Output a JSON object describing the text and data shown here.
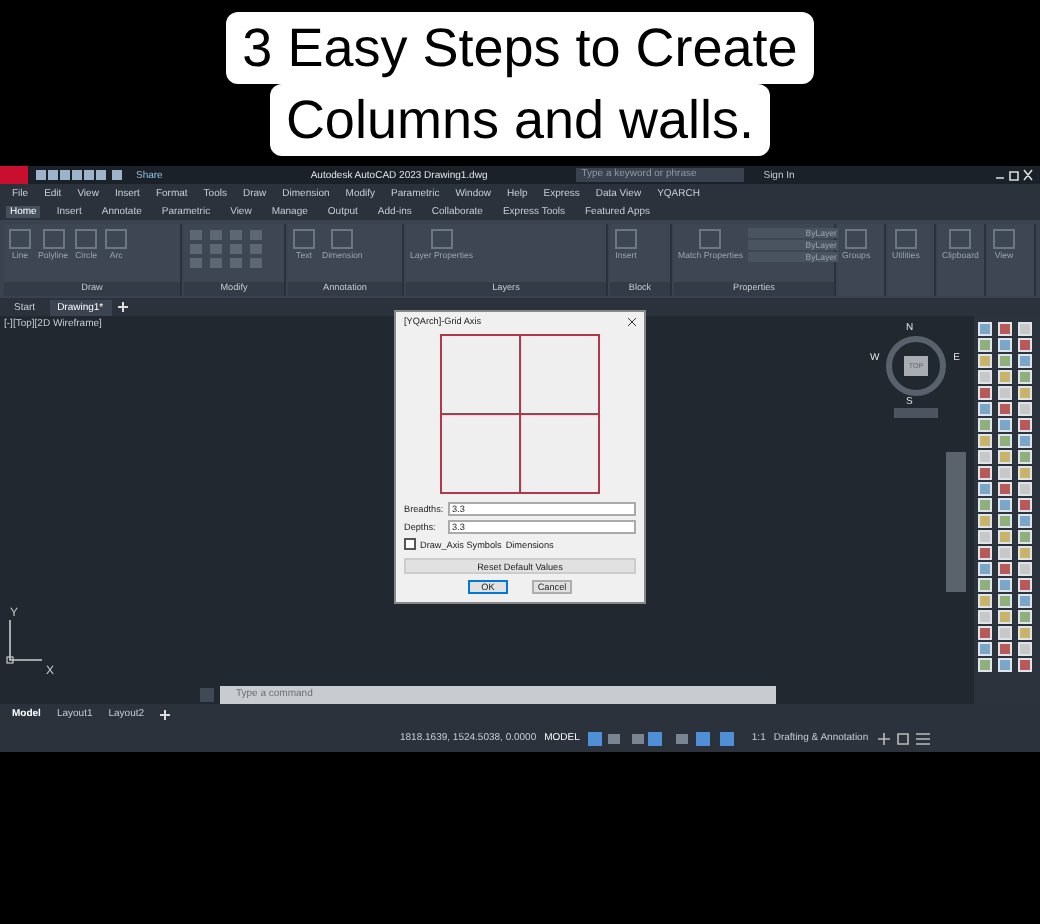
{
  "caption": {
    "lines": [
      "3 Easy Steps to Create",
      "Columns and walls."
    ]
  },
  "title_bar": {
    "share": "Share",
    "title": "Autodesk AutoCAD 2023   Drawing1.dwg",
    "search": {
      "placeholder": "Type a keyword or phrase"
    },
    "sign_in": "Sign In"
  },
  "menu_bar": [
    "File",
    "Edit",
    "View",
    "Insert",
    "Format",
    "Tools",
    "Draw",
    "Dimension",
    "Modify",
    "Parametric",
    "Window",
    "Help",
    "Express",
    "Data View",
    "YQARCH"
  ],
  "ribbon_tabs": [
    {
      "label": "Home",
      "selected": true
    },
    {
      "label": "Insert",
      "selected": false
    },
    {
      "label": "Annotate",
      "selected": false
    },
    {
      "label": "Parametric",
      "selected": false
    },
    {
      "label": "View",
      "selected": false
    },
    {
      "label": "Manage",
      "selected": false
    },
    {
      "label": "Output",
      "selected": false
    },
    {
      "label": "Add-ins",
      "selected": false
    },
    {
      "label": "Collaborate",
      "selected": false
    },
    {
      "label": "Express Tools",
      "selected": false
    },
    {
      "label": "Featured Apps",
      "selected": false
    }
  ],
  "ribbon_panels": [
    {
      "title": "Draw",
      "tools": [
        "Line",
        "Polyline",
        "Circle",
        "Arc"
      ]
    },
    {
      "title": "Modify"
    },
    {
      "title": "Annotation",
      "tools": [
        "Text",
        "Dimension"
      ]
    },
    {
      "title": "Layers",
      "tools": [
        "Layer Properties"
      ]
    },
    {
      "title": "Block",
      "tools": [
        "Insert"
      ]
    },
    {
      "title": "Properties",
      "tools": [
        "Match Properties"
      ],
      "dropdowns": [
        "ByLayer",
        "ByLayer",
        "ByLayer"
      ]
    },
    {
      "tools": [
        "Groups"
      ]
    },
    {
      "tools": [
        "Utilities"
      ]
    },
    {
      "tools": [
        "Clipboard"
      ]
    },
    {
      "tools": [
        "View"
      ]
    }
  ],
  "file_tabs": [
    {
      "label": "Start",
      "selected": false
    },
    {
      "label": "Drawing1*",
      "selected": true
    }
  ],
  "viewport_label": "[-][Top][2D Wireframe]",
  "viewcube": {
    "face": "TOP",
    "north": "N",
    "south": "S",
    "east": "E",
    "west": "W"
  },
  "ucs": {
    "x": "X",
    "y": "Y"
  },
  "dialog": {
    "title": "[YQArch]-Grid Axis",
    "fields": [
      {
        "label": "Breadths:",
        "value": "3.3"
      },
      {
        "label": "Depths:",
        "value": "3.3"
      }
    ],
    "checkbox": {
      "label": "Draw_Axis Symbols",
      "checked": false
    },
    "extra_label": "Dimensions",
    "reset": "Reset Default Values",
    "buttons": [
      "OK",
      "Cancel"
    ]
  },
  "command_line": {
    "placeholder": "Type a command"
  },
  "layout_tabs": [
    {
      "label": "Model",
      "selected": true
    },
    {
      "label": "Layout1",
      "selected": false
    },
    {
      "label": "Layout2",
      "selected": false
    }
  ],
  "status_bar": {
    "coordinates": "1818.1639, 1524.5038, 0.0000",
    "mode": "MODEL",
    "scale": "1:1",
    "workspace": "Drafting & Annotation"
  }
}
